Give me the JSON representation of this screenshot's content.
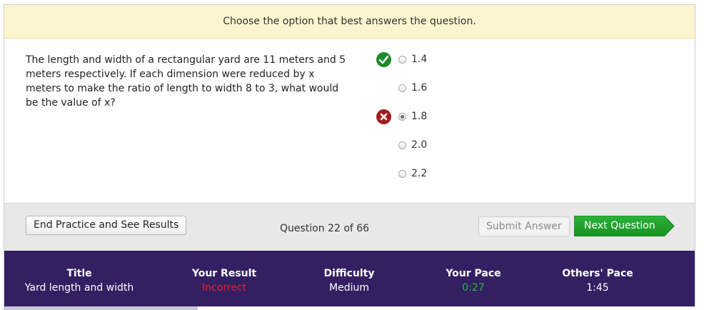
{
  "instruction": "Choose the option that best answers the question.",
  "question": {
    "text": "The length and width of a rectangular yard are 11 meters and 5 meters respectively. If each dimension were reduced by x meters to make the ratio of length to width 8 to 3, what would be the value of x?"
  },
  "options": [
    {
      "label": "1.4",
      "status": "correct",
      "selected": false
    },
    {
      "label": "1.6",
      "status": "",
      "selected": false
    },
    {
      "label": "1.8",
      "status": "incorrect",
      "selected": true
    },
    {
      "label": "2.0",
      "status": "",
      "selected": false
    },
    {
      "label": "2.2",
      "status": "",
      "selected": false
    }
  ],
  "controls": {
    "end_label": "End Practice and See Results",
    "counter": "Question 22 of 66",
    "submit_label": "Submit Answer",
    "next_label": "Next Question"
  },
  "stats": {
    "title_label": "Title",
    "title_value": "Yard length and width",
    "result_label": "Your Result",
    "result_value": "Incorrect",
    "difficulty_label": "Difficulty",
    "difficulty_value": "Medium",
    "pace_label": "Your Pace",
    "pace_value": "0:27",
    "others_label": "Others' Pace",
    "others_value": "1:45"
  },
  "colors": {
    "correct": "#1e8a2a",
    "incorrect": "#e0232a",
    "pace": "#27b53a",
    "stats_bg": "#341f63",
    "next_button": "#1a9a26"
  }
}
